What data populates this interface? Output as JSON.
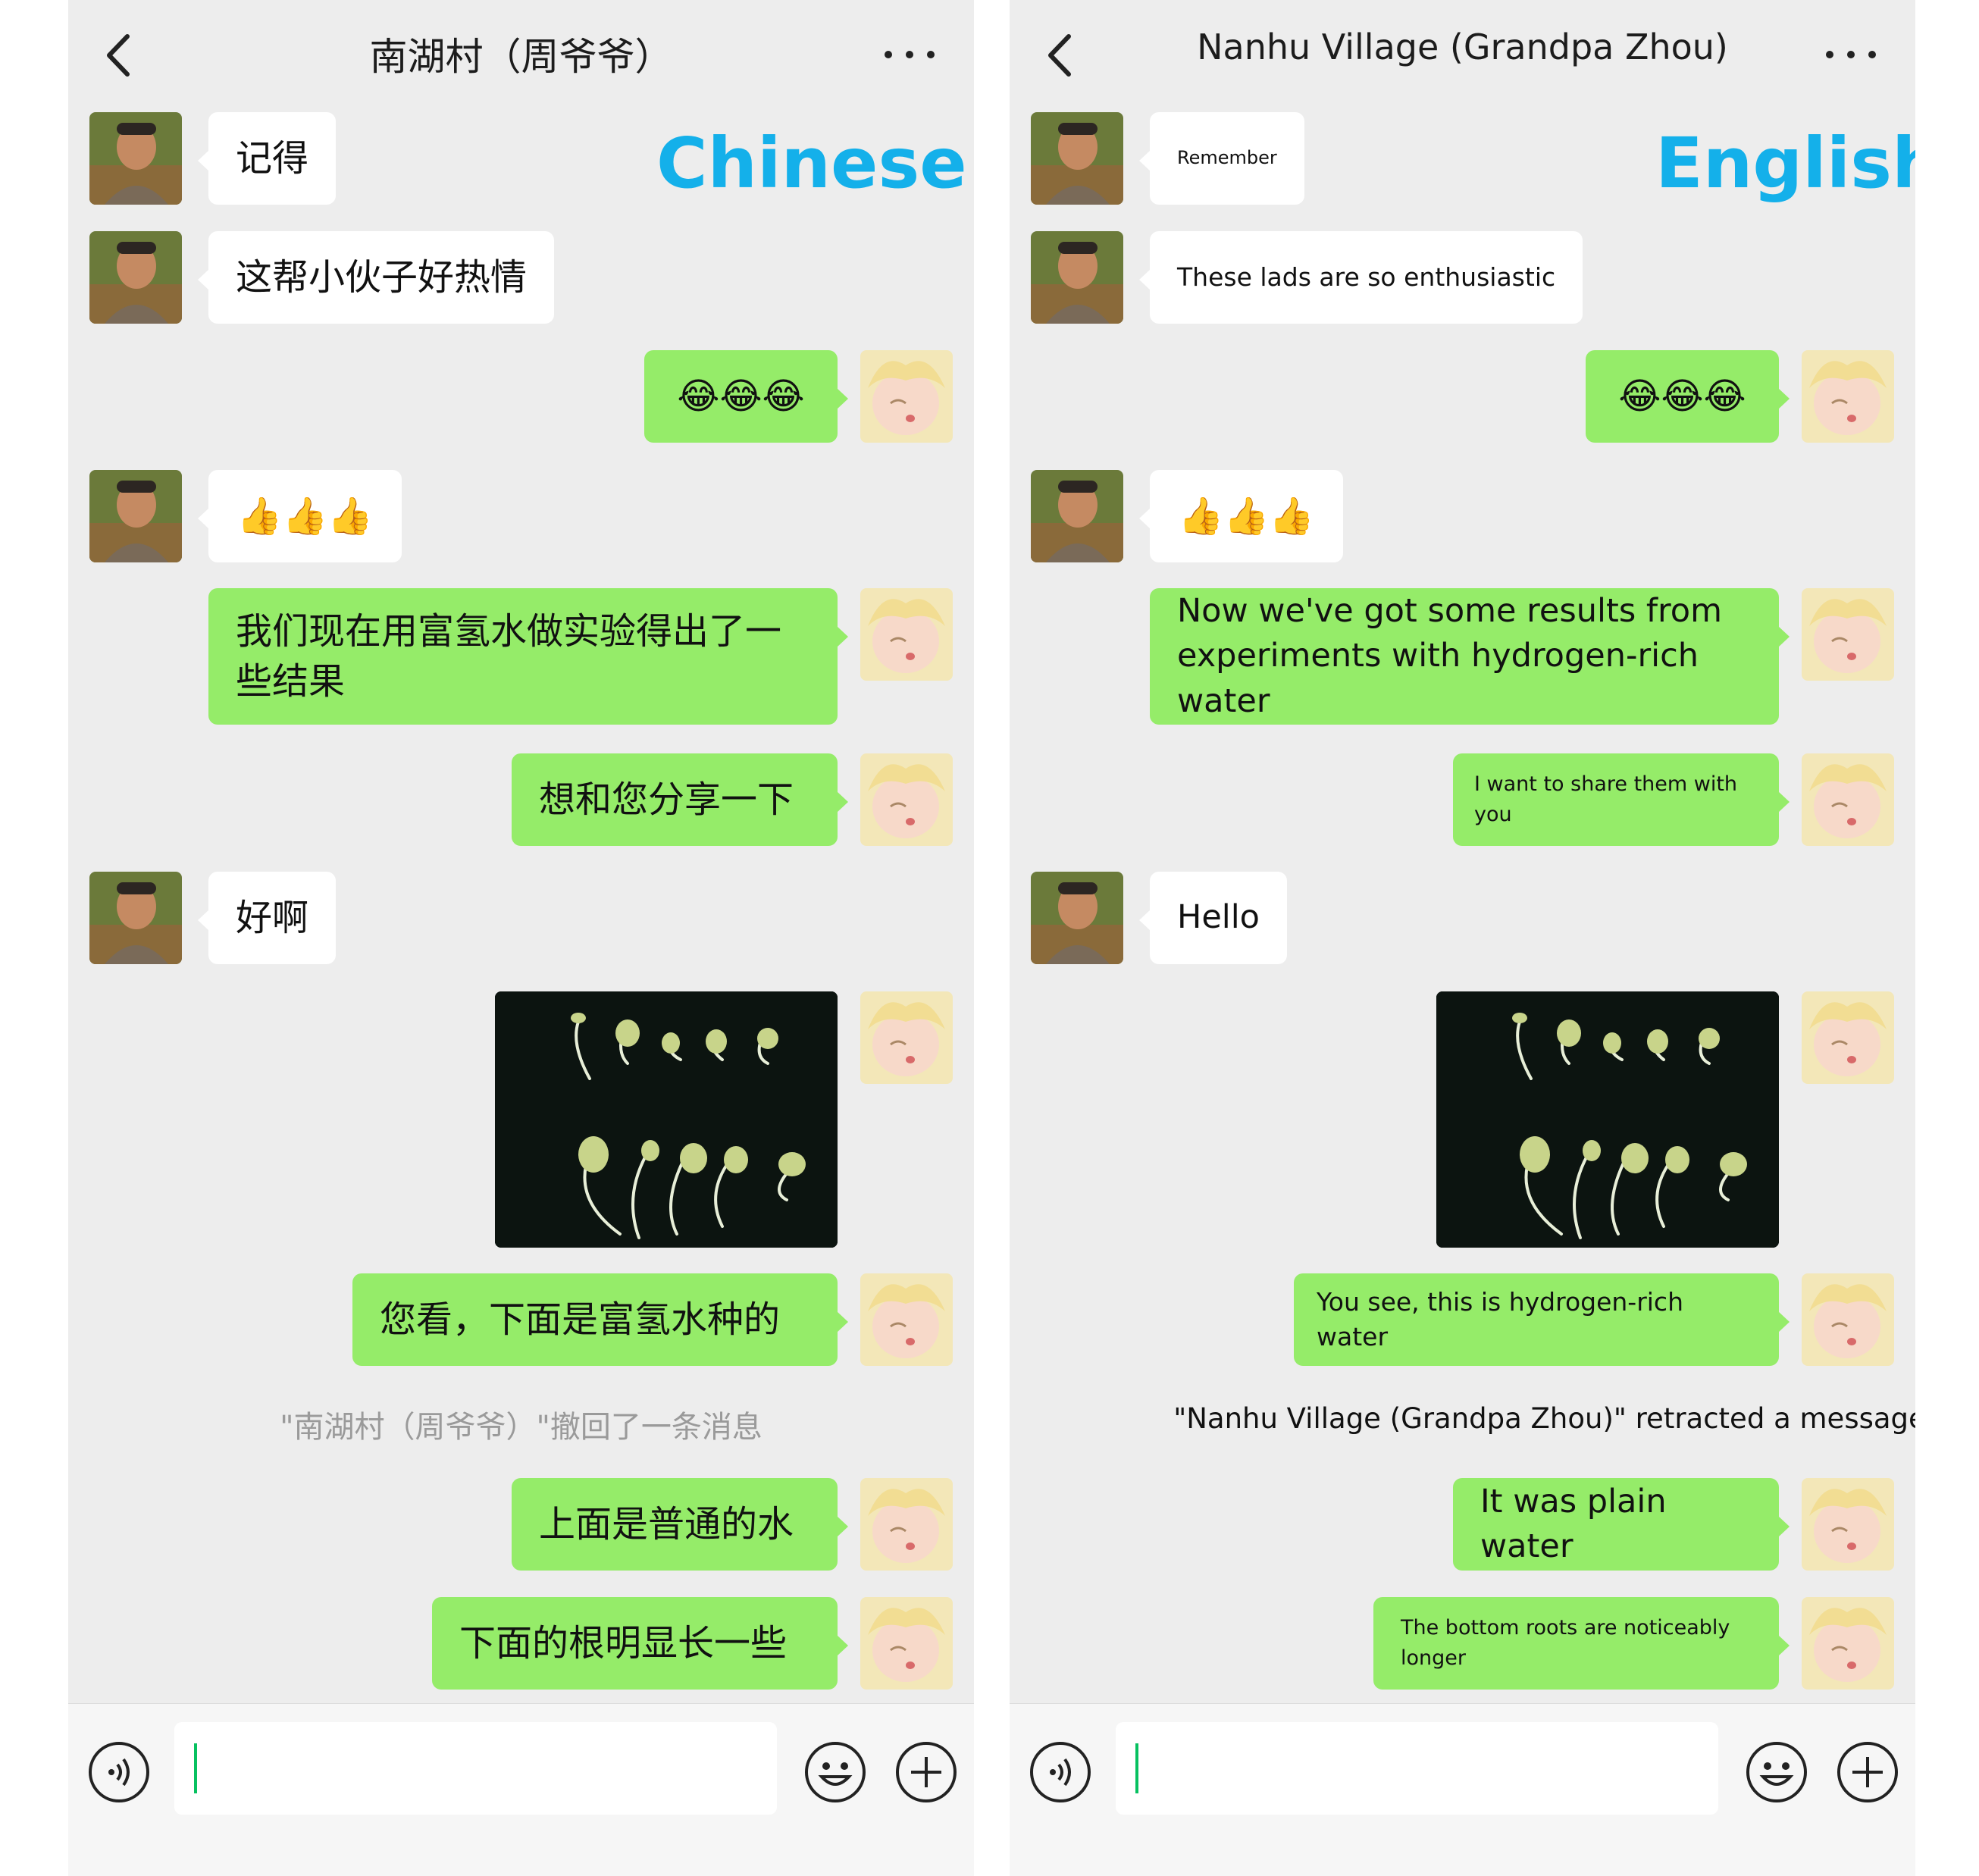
{
  "panels": [
    {
      "lang_label": "Chinese",
      "title": "南湖村（周爷爷）",
      "messages": {
        "m1": "记得",
        "m2": "这帮小伙子好热情",
        "m3": "😂😂😂",
        "m4": "👍👍👍",
        "m5": "我们现在用富氢水做实验得出了一些结果",
        "m6": "想和您分享一下",
        "m7": "好啊",
        "m8": "您看，下面是富氢水种的",
        "m9": "上面是普通的水",
        "m10": "下面的根明显长一些"
      },
      "retract_notice": "\"南湖村（周爷爷）\"撤回了一条消息"
    },
    {
      "lang_label": "English",
      "title": "Nanhu Village (Grandpa Zhou)",
      "messages": {
        "m1": "Remember",
        "m2": "These lads are so enthusiastic",
        "m3": "😂😂😂",
        "m4": "👍👍👍",
        "m5": "Now we've got some results from experiments with hydrogen-rich water",
        "m6": "I want to share them with you",
        "m7": "Hello",
        "m8": "You see, this is hydrogen-rich water",
        "m9": "It was plain water",
        "m10": "The bottom roots are noticeably longer"
      },
      "retract_notice": "\"Nanhu Village (Grandpa Zhou)\" retracted a message"
    }
  ],
  "icons": {
    "back": "chevron-left-icon",
    "more": "ellipsis-icon",
    "voice": "voice-icon",
    "emoji": "smiley-icon",
    "plus": "plus-icon"
  },
  "colors": {
    "sent_bubble": "#95ec69",
    "received_bubble": "#ffffff",
    "background": "#ededed",
    "label": "#14b0ea"
  }
}
